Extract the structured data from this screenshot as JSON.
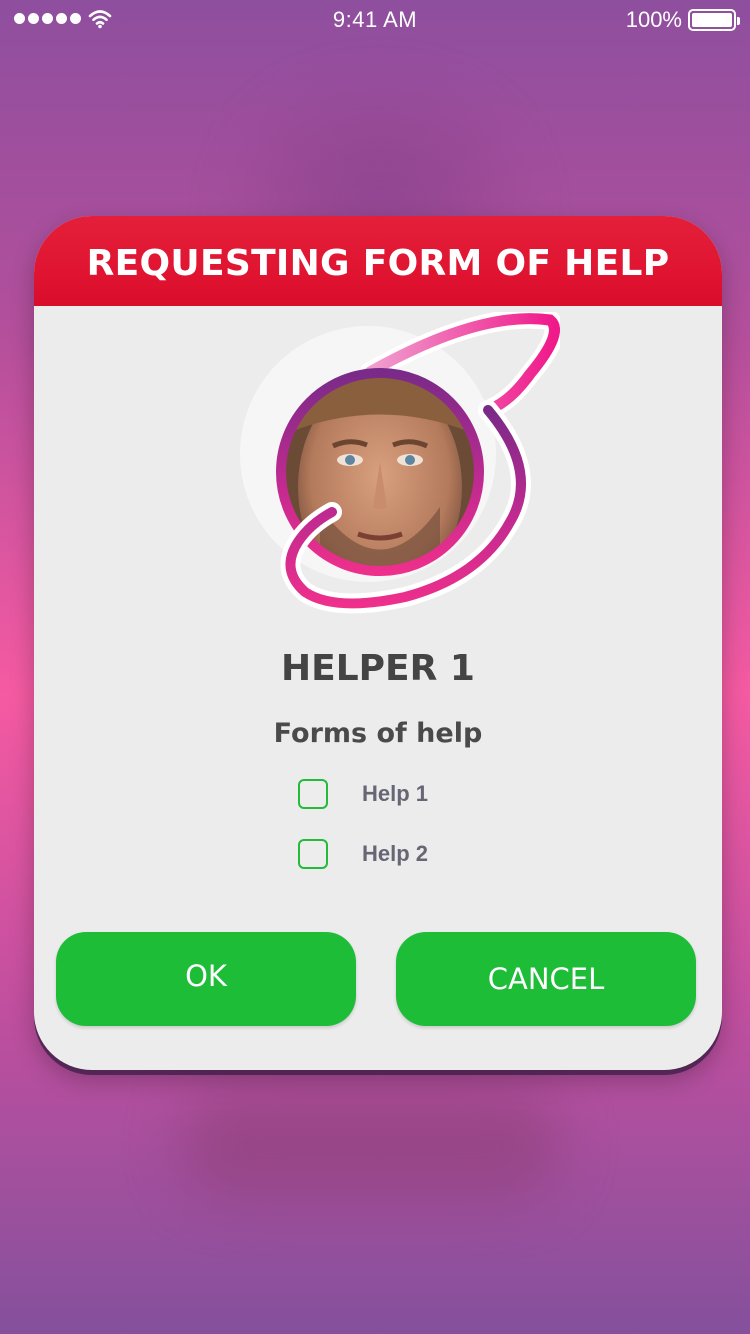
{
  "status_bar": {
    "time": "9:41 AM",
    "battery_percent": "100%",
    "signal_icon": "signal-dots-icon",
    "wifi_icon": "wifi-icon",
    "battery_icon": "battery-icon"
  },
  "dialog": {
    "title": "REQUESTING FORM OF HELP",
    "helper_name": "HELPER 1",
    "forms_label": "Forms of help",
    "options": [
      {
        "label": "Help 1",
        "checked": false
      },
      {
        "label": "Help 2",
        "checked": false
      }
    ],
    "ok_label": "OK",
    "cancel_label": "CANCEL",
    "avatar_icon": "helper-avatar"
  },
  "colors": {
    "header_red": "#df1330",
    "button_green": "#1dbd38",
    "checkbox_border": "#22bb3a",
    "orbit_pink": "#ee2f8c",
    "orbit_purple": "#8a2a8a"
  }
}
